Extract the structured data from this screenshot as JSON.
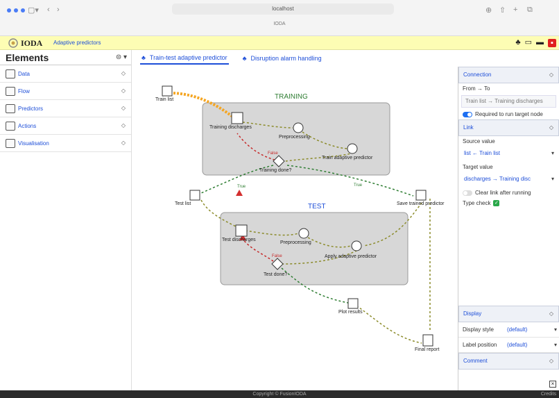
{
  "browser": {
    "url": "localhost",
    "tab_title": "IODA"
  },
  "header": {
    "brand": "IODA",
    "title": "Adaptive predictors"
  },
  "sidebar": {
    "title": "Elements",
    "items": [
      {
        "label": "Data",
        "icon": "database-icon"
      },
      {
        "label": "Flow",
        "icon": "flow-icon"
      },
      {
        "label": "Predictors",
        "icon": "predictor-icon"
      },
      {
        "label": "Actions",
        "icon": "actions-icon"
      },
      {
        "label": "Visualisation",
        "icon": "visualisation-icon"
      }
    ]
  },
  "tabs": [
    {
      "label": "Train-test adaptive predictor",
      "active": true
    },
    {
      "label": "Disruption alarm handling",
      "active": false
    }
  ],
  "canvas": {
    "groups": {
      "training": "TRAINING",
      "test": "TEST"
    },
    "nodes": {
      "train_list": "Train list",
      "training_discharges": "Training discharges",
      "preprocessing_1": "Preprocessing",
      "train_predictor": "Train adaptive predictor",
      "training_done": "Training done?",
      "test_list": "Test list",
      "save_predictor": "Save trained predictor",
      "test_discharges": "Test discharges",
      "preprocessing_2": "Preprocessing",
      "apply_predictor": "Apply adaptive predictor",
      "test_done": "Test done?",
      "plot_results": "Plot results",
      "final_report": "Final report"
    },
    "edge_labels": {
      "true_1": "True",
      "true_2": "True",
      "false_1": "False",
      "false_2": "False"
    }
  },
  "panel": {
    "connection": {
      "title": "Connection",
      "from_to_label": "From → To",
      "from_to_value": "Train list → Training discharges",
      "required_label": "Required to run target node",
      "required_on": true
    },
    "link": {
      "title": "Link",
      "source_label": "Source value",
      "source_value": "list ← Train list",
      "target_label": "Target value",
      "target_value": "discharges → Training disc",
      "clear_label": "Clear link after running",
      "type_check_label": "Type check"
    },
    "display": {
      "title": "Display",
      "style_label": "Display style",
      "style_value": "(default)",
      "label_position_label": "Label position",
      "label_position_value": "(default)"
    },
    "comment": {
      "title": "Comment"
    }
  },
  "footer": {
    "copyright": "Copyright © FusionIODA",
    "credits": "Credits"
  },
  "colors": {
    "accent": "#1d4ed8",
    "header_bg": "#fdfdb4",
    "edge": "#8b8b2a",
    "true_edge": "#2e7d32",
    "false_edge": "#c62828",
    "selected_edge": "#f5a623"
  }
}
